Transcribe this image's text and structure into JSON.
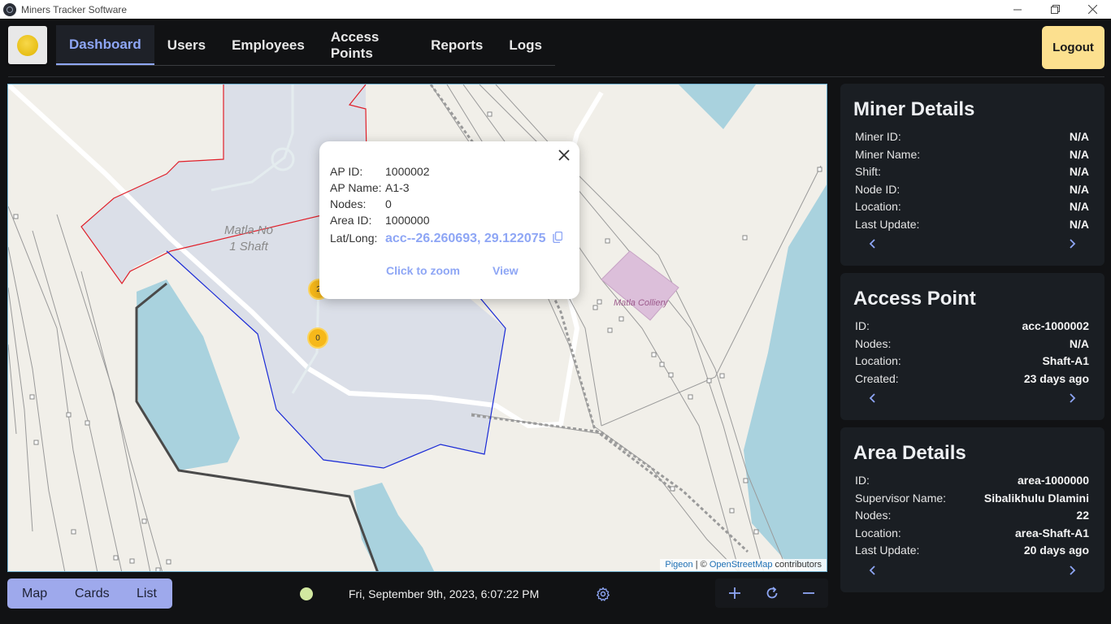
{
  "window": {
    "title": "Miners Tracker Software",
    "controls": [
      "minimize",
      "restore",
      "close"
    ]
  },
  "nav": {
    "tabs": [
      {
        "label": "Dashboard",
        "active": true
      },
      {
        "label": "Users",
        "active": false
      },
      {
        "label": "Employees",
        "active": false
      },
      {
        "label": "Access Points",
        "active": false
      },
      {
        "label": "Reports",
        "active": false
      },
      {
        "label": "Logs",
        "active": false
      }
    ],
    "logout_label": "Logout"
  },
  "map": {
    "labels": {
      "shaft": "Matla No\n1 Shaft",
      "colliery": "Matla Colliery"
    },
    "clusters": [
      "2",
      "0"
    ],
    "attribution": {
      "pigeon": "Pigeon",
      "separator": " | © ",
      "osm": "OpenStreetMap",
      "contributors": " contributors"
    },
    "popup": {
      "rows": [
        {
          "key": "AP ID:",
          "value": "1000002"
        },
        {
          "key": "AP Name:",
          "value": "A1-3"
        },
        {
          "key": "Nodes:",
          "value": "0"
        },
        {
          "key": "Area ID:",
          "value": "1000000"
        }
      ],
      "latlong_key": "Lat/Long:",
      "latlong_value": "acc--26.260693, 29.122075",
      "zoom_label": "Click to zoom",
      "view_label": "View"
    }
  },
  "miner_details": {
    "title": "Miner Details",
    "rows": [
      {
        "key": "Miner ID:",
        "value": "N/A"
      },
      {
        "key": "Miner Name:",
        "value": "N/A"
      },
      {
        "key": "Shift:",
        "value": "N/A"
      },
      {
        "key": "Node ID:",
        "value": "N/A"
      },
      {
        "key": "Location:",
        "value": "N/A"
      },
      {
        "key": "Last Update:",
        "value": "N/A"
      }
    ]
  },
  "access_point": {
    "title": "Access Point",
    "rows": [
      {
        "key": "ID:",
        "value": "acc-1000002"
      },
      {
        "key": "Nodes:",
        "value": "N/A"
      },
      {
        "key": "Location:",
        "value": "Shaft-A1"
      },
      {
        "key": "Created:",
        "value": "23 days ago"
      }
    ]
  },
  "area_details": {
    "title": "Area Details",
    "rows": [
      {
        "key": "ID:",
        "value": "area-1000000"
      },
      {
        "key": "Supervisor Name:",
        "value": "Sibalikhulu Dlamini"
      },
      {
        "key": "Nodes:",
        "value": "22"
      },
      {
        "key": "Location:",
        "value": "area-Shaft-A1"
      },
      {
        "key": "Last Update:",
        "value": "20 days ago"
      }
    ]
  },
  "bottom": {
    "view_tabs": [
      "Map",
      "Cards",
      "List"
    ],
    "datetime": "Fri, September 9th, 2023, 6:07:22 PM"
  },
  "colors": {
    "accent": "#8ea6f5",
    "logout": "#fce08f",
    "panel_bg": "#1a1e23",
    "app_bg": "#111214",
    "status_dot": "#d2e8a0",
    "cluster": "#f6b81a"
  },
  "icons": [
    "app-icon",
    "logo-icon",
    "close-icon",
    "copy-icon",
    "chevron-left-icon",
    "chevron-right-icon",
    "gear-icon",
    "zoom-in-icon",
    "refresh-icon",
    "zoom-out-icon"
  ]
}
